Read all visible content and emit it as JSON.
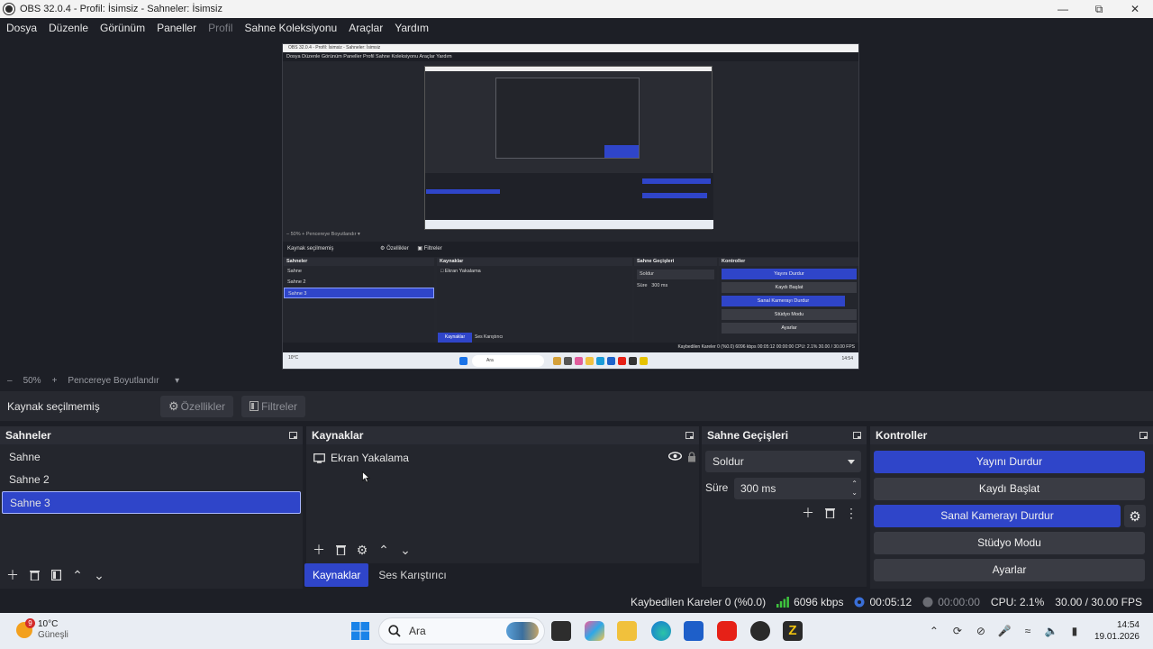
{
  "window": {
    "title": "OBS 32.0.4 - Profil: İsimsiz - Sahneler: İsimsiz",
    "controls": [
      "minimize",
      "maximize",
      "close"
    ]
  },
  "menu": [
    "Dosya",
    "Düzenle",
    "Görünüm",
    "Paneller",
    "Profil",
    "Sahne Koleksiyonu",
    "Araçlar",
    "Yardım"
  ],
  "menu_disabled": [
    "Profil"
  ],
  "preview": {
    "inner_title": "OBS 32.0.4 - Profil: İsimsiz - Sahneler: İsimsiz",
    "inner_menu": "Dosya   Düzenle   Görünüm   Paneller   Profil   Sahne Koleksiyonu   Araçlar   Yardım",
    "zoom_line": "–   50%   +   Pencereye Boyutlandır   ▾",
    "no_source": "Kaynak seçilmemiş",
    "props": "Özellikler",
    "filters": "Filtreler",
    "scenes_header": "Sahneler",
    "scenes": [
      "Sahne",
      "Sahne 2",
      "Sahne 3"
    ],
    "sources_header": "Kaynaklar",
    "source": "Ekran Yakalama",
    "trans_header": "Sahne Geçişleri",
    "trans": "Soldur",
    "dur_label": "Süre",
    "dur": "300 ms",
    "ctl_header": "Kontroller",
    "ctl": [
      "Yayını Durdur",
      "Kaydı Başlat",
      "Sanal Kamerayı Durdur",
      "Stüdyo Modu",
      "Ayarlar"
    ],
    "tab1": "Kaynaklar",
    "tab2": "Ses Karıştırıcı",
    "status": "Kaybedilen Kareler 0 (%0.0)   6096 kbps   00:05:12   00:00:00   CPU: 2.1%   30.00 / 30.00 FPS",
    "task_weather": "10°C",
    "task_search": "Ara",
    "task_time": "14:54"
  },
  "zoombar": {
    "minus": "–",
    "zoom": "50%",
    "plus": "+",
    "fit": "Pencereye Boyutlandır"
  },
  "source_toolbar": {
    "no_source": "Kaynak seçilmemiş",
    "properties": "Özellikler",
    "filters": "Filtreler"
  },
  "scenes": {
    "header": "Sahneler",
    "items": [
      "Sahne",
      "Sahne 2",
      "Sahne 3"
    ],
    "selected": "Sahne 3"
  },
  "sources": {
    "header": "Kaynaklar",
    "items": [
      {
        "name": "Ekran Yakalama",
        "visible": true,
        "locked": true
      }
    ],
    "tabs": [
      "Kaynaklar",
      "Ses Karıştırıcı"
    ],
    "active_tab": "Kaynaklar"
  },
  "transitions": {
    "header": "Sahne Geçişleri",
    "selected": "Soldur",
    "duration_label": "Süre",
    "duration": "300 ms"
  },
  "controls": {
    "header": "Kontroller",
    "stop_stream": "Yayını Durdur",
    "start_record": "Kaydı Başlat",
    "stop_virtualcam": "Sanal Kamerayı Durdur",
    "studio_mode": "Stüdyo Modu",
    "settings": "Ayarlar"
  },
  "status": {
    "dropped": "Kaybedilen Kareler 0 (%0.0)",
    "bitrate": "6096 kbps",
    "stream_time": "00:05:12",
    "record_time": "00:00:00",
    "cpu": "CPU: 2.1%",
    "fps": "30.00 / 30.00 FPS"
  },
  "taskbar": {
    "weather_temp": "10°C",
    "weather_desc": "Güneşli",
    "weather_badge": "9",
    "search": "Ara",
    "time": "14:54",
    "date": "19.01.2026"
  },
  "colors": {
    "accent": "#2f45c9",
    "bg": "#1d1f26",
    "dock": "#24262d"
  }
}
